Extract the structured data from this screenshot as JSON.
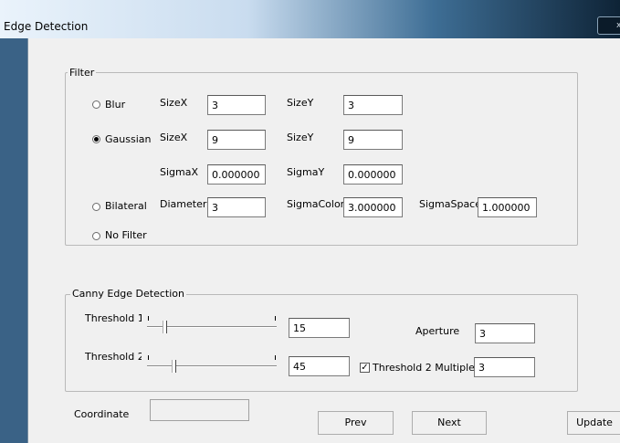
{
  "window": {
    "title": "Edge Detection",
    "close_glyph": "x"
  },
  "filter": {
    "group_label": "Filter",
    "blur": {
      "label": "Blur",
      "sizex_label": "SizeX",
      "sizex": "3",
      "sizey_label": "SizeY",
      "sizey": "3"
    },
    "gaussian": {
      "label": "Gaussian",
      "sizex_label": "SizeX",
      "sizex": "9",
      "sizey_label": "SizeY",
      "sizey": "9",
      "sigmax_label": "SigmaX",
      "sigmax": "0.000000",
      "sigmay_label": "SigmaY",
      "sigmay": "0.000000"
    },
    "bilateral": {
      "label": "Bilateral",
      "diameter_label": "Diameter",
      "diameter": "3",
      "sigmacolor_label": "SigmaColor",
      "sigmacolor": "3.000000",
      "sigmaspace_label": "SigmaSpace",
      "sigmaspace": "1.000000"
    },
    "nofilter": {
      "label": "No Filter"
    },
    "selected": "gaussian"
  },
  "canny": {
    "group_label": "Canny Edge Detection",
    "threshold1": {
      "label": "Threshold 1",
      "value": "15"
    },
    "threshold2": {
      "label": "Threshold 2",
      "value": "45"
    },
    "aperture_label": "Aperture",
    "aperture": "3",
    "multiple_label": "Threshold 2 Multiple",
    "multiple": "3",
    "multiple_checked": true
  },
  "coordinate_label": "Coordinate",
  "coordinate": "",
  "buttons": {
    "prev": "Prev",
    "next": "Next",
    "update": "Update"
  }
}
